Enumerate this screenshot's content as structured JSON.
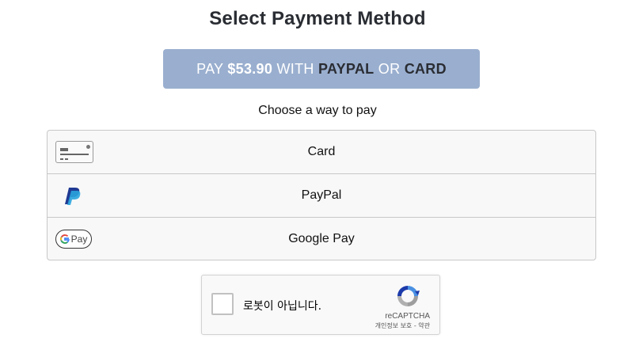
{
  "page": {
    "title": "Select Payment Method"
  },
  "pay_button": {
    "prefix": "PAY ",
    "amount": "$53.90",
    "with": " WITH ",
    "paypal": "PAYPAL",
    "or": " OR ",
    "card": "CARD",
    "color": "#9aafcf"
  },
  "choose_label": "Choose a way to pay",
  "methods": [
    {
      "label": "Card",
      "icon": "credit-card-icon"
    },
    {
      "label": "PayPal",
      "icon": "paypal-icon"
    },
    {
      "label": "Google Pay",
      "icon": "google-pay-icon",
      "icon_text": "Pay"
    }
  ],
  "recaptcha": {
    "label": "로봇이 아닙니다.",
    "brand": "reCAPTCHA",
    "links": "개인정보 보호 - 약관"
  }
}
